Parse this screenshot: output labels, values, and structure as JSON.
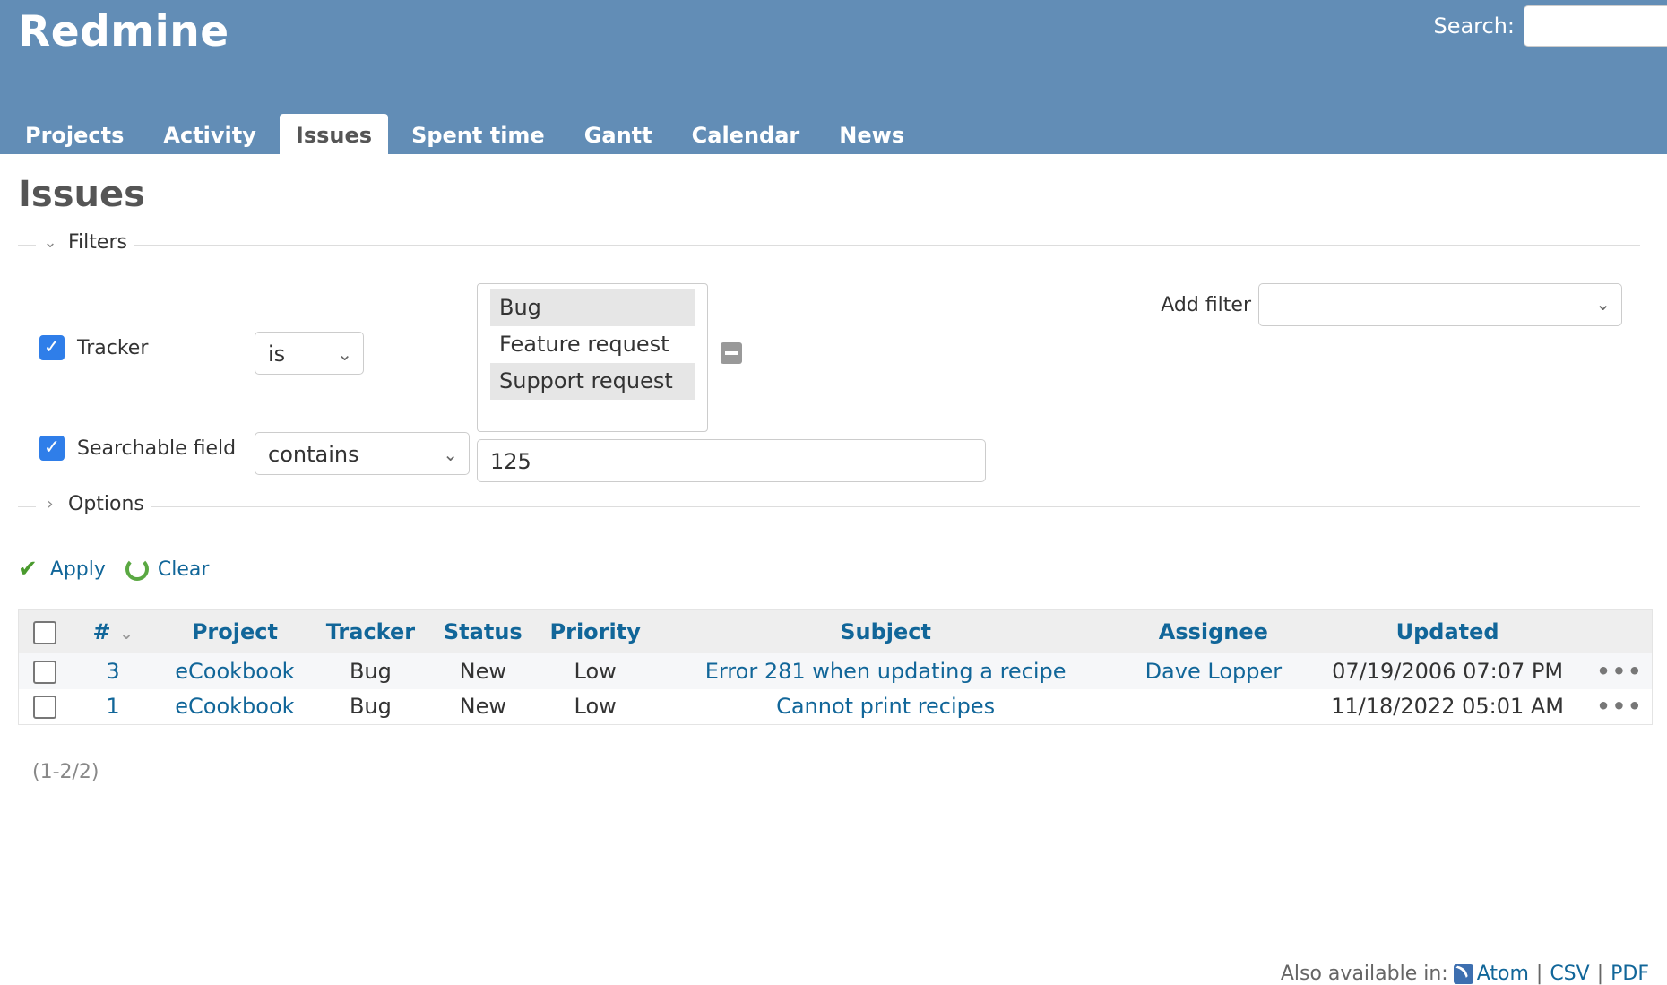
{
  "app": {
    "title": "Redmine"
  },
  "search": {
    "label": "Search:",
    "value": ""
  },
  "menu": [
    {
      "label": "Projects",
      "selected": false
    },
    {
      "label": "Activity",
      "selected": false
    },
    {
      "label": "Issues",
      "selected": true
    },
    {
      "label": "Spent time",
      "selected": false
    },
    {
      "label": "Gantt",
      "selected": false
    },
    {
      "label": "Calendar",
      "selected": false
    },
    {
      "label": "News",
      "selected": false
    }
  ],
  "page": {
    "title": "Issues"
  },
  "filters": {
    "legend": "Filters",
    "tracker": {
      "label": "Tracker",
      "checked": true,
      "operator": "is",
      "options": [
        {
          "label": "Bug",
          "selected": true
        },
        {
          "label": "Feature request",
          "selected": false
        },
        {
          "label": "Support request",
          "selected": true
        }
      ]
    },
    "searchable": {
      "label": "Searchable field",
      "checked": true,
      "operator": "contains",
      "value": "125"
    },
    "add_filter": {
      "label": "Add filter",
      "value": ""
    }
  },
  "options": {
    "legend": "Options"
  },
  "buttons": {
    "apply": "Apply",
    "clear": "Clear"
  },
  "table": {
    "columns": [
      "#",
      "Project",
      "Tracker",
      "Status",
      "Priority",
      "Subject",
      "Assignee",
      "Updated"
    ],
    "rows": [
      {
        "id": "3",
        "project": "eCookbook",
        "tracker": "Bug",
        "status": "New",
        "priority": "Low",
        "subject": "Error 281 when updating a recipe",
        "assignee": "Dave Lopper",
        "updated": "07/19/2006 07:07 PM",
        "more": "•••"
      },
      {
        "id": "1",
        "project": "eCookbook",
        "tracker": "Bug",
        "status": "New",
        "priority": "Low",
        "subject": "Cannot print recipes",
        "assignee": "",
        "updated": "11/18/2022 05:01 AM",
        "more": "•••"
      }
    ]
  },
  "pagination": {
    "text": "(1-2/2)"
  },
  "formats": {
    "label": "Also available in:",
    "atom": "Atom",
    "csv": "CSV",
    "pdf": "PDF",
    "separator": "|"
  },
  "colors": {
    "header": "#628db6",
    "link": "#169",
    "checkbox": "#2f7ee9"
  }
}
